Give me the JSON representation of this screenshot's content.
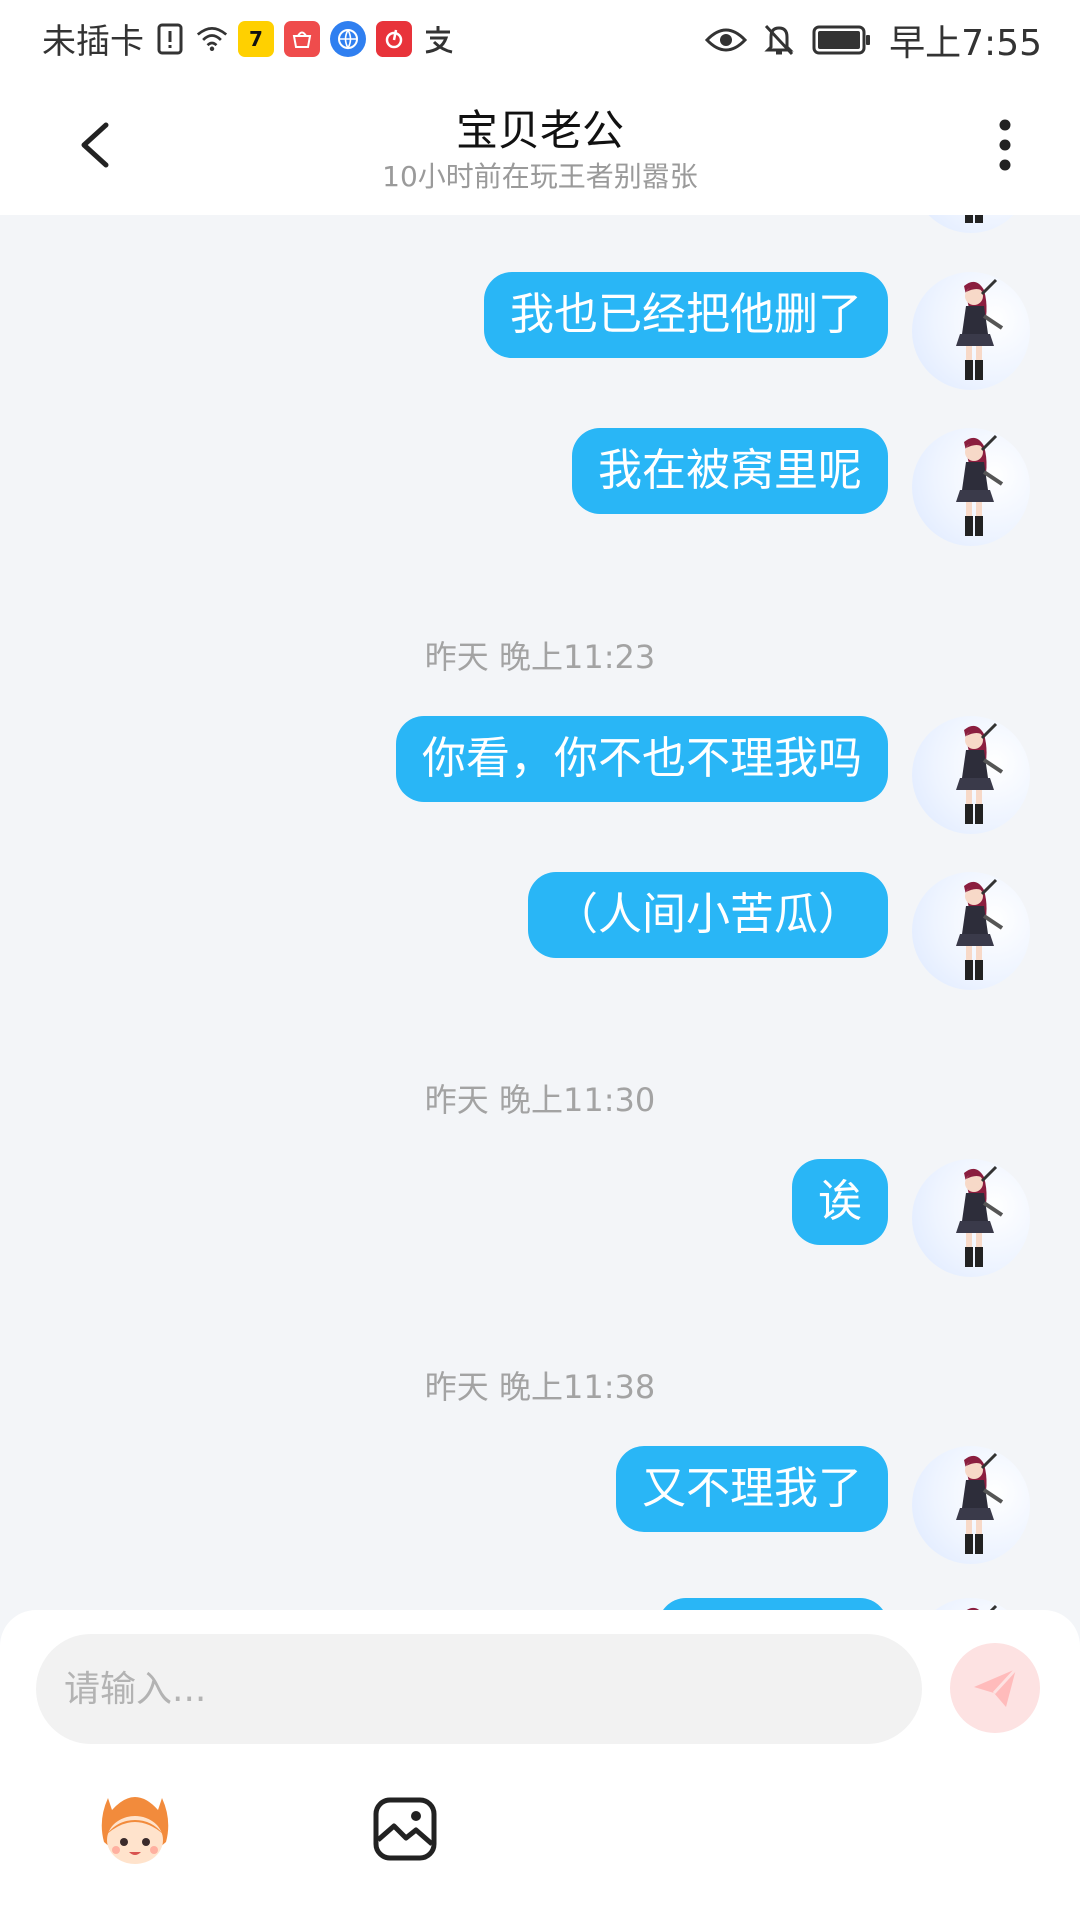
{
  "status_bar": {
    "carrier": "未插卡",
    "time": "早上7:55",
    "notification_icons": [
      "sim-alert-icon",
      "wifi-icon",
      "app-7-icon",
      "huawei-store-icon",
      "browser-icon",
      "netease-music-icon",
      "alipay-icon"
    ],
    "right_icons": [
      "eye-icon",
      "mute-bell-icon",
      "battery-icon"
    ],
    "app_badge_text": "7"
  },
  "header": {
    "title": "宝贝老公",
    "subtitle": "10小时前在玩王者别嚣张"
  },
  "messages": [
    {
      "type": "text",
      "text": "我也已经把他删了"
    },
    {
      "type": "text",
      "text": "我在被窝里呢"
    },
    {
      "type": "time",
      "text": "昨天 晚上11:23"
    },
    {
      "type": "text",
      "text": "你看，你不也不理我吗"
    },
    {
      "type": "text",
      "text": "（人间小苦瓜）"
    },
    {
      "type": "time",
      "text": "昨天 晚上11:30"
    },
    {
      "type": "text",
      "text": "诶"
    },
    {
      "type": "time",
      "text": "昨天 晚上11:38"
    },
    {
      "type": "text",
      "text": "又不理我了"
    }
  ],
  "input": {
    "placeholder": "请输入..."
  },
  "colors": {
    "bubble": "#29b6f6",
    "background": "#f3f5f8",
    "send_button": "#fde2e2"
  }
}
